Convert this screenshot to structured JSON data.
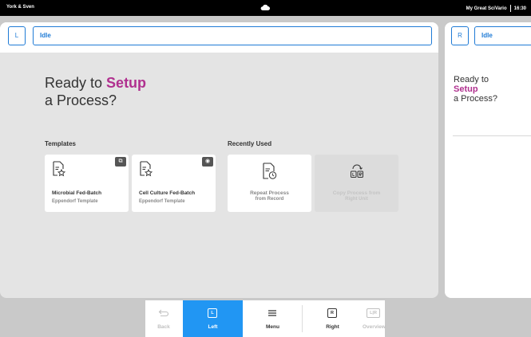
{
  "topbar": {
    "left_text": "York & Sven",
    "right_text": "My Great SciVario",
    "time": "16:30"
  },
  "left_unit": {
    "badge": "L",
    "status": "Idle",
    "heading_line1_prefix": "Ready to ",
    "heading_line1_highlight": "Setup",
    "heading_line2": "a Process?",
    "templates_label": "Templates",
    "recent_label": "Recently Used",
    "cards": [
      {
        "title": "Microbial Fed-Batch",
        "subtitle": "Eppendorf Template",
        "corner_icon": "bacteria-icon"
      },
      {
        "title": "Cell Culture Fed-Batch",
        "subtitle": "Eppendorf Template",
        "corner_icon": "cell-icon"
      },
      {
        "title": "Repeat Process",
        "subtitle": "from Record"
      },
      {
        "title": "Copy Process from",
        "subtitle": "Right Unit",
        "disabled": true
      }
    ]
  },
  "right_unit": {
    "badge": "R",
    "status": "Idle",
    "heading_line1": "Ready to",
    "heading_highlight": "Setup",
    "heading_line3": "a Process?"
  },
  "navbar": {
    "items": [
      {
        "label": "Back",
        "icon": "back-arrow-icon",
        "disabled": true
      },
      {
        "label": "Left",
        "key": "L",
        "active": true
      },
      {
        "label": "Menu",
        "icon": "menu-icon"
      },
      {
        "label": "Right",
        "key": "R"
      },
      {
        "label": "Overview",
        "key": "L|R",
        "disabled": true
      }
    ]
  },
  "colors": {
    "accent_blue": "#2196f3",
    "highlight_magenta": "#b0308f",
    "background": "#e4e4e4"
  }
}
